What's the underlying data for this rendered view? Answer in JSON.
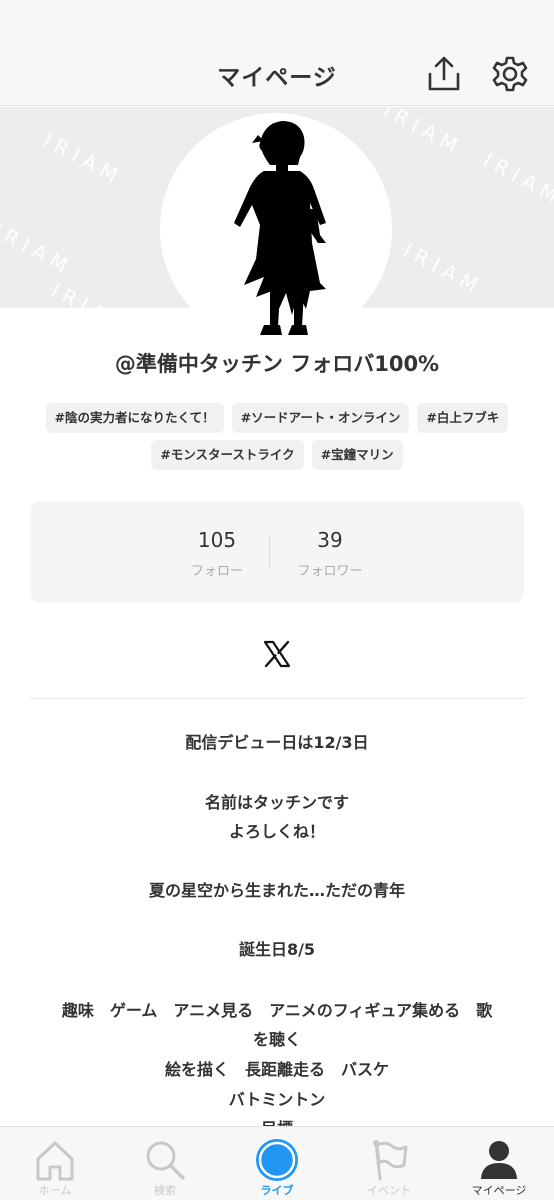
{
  "header": {
    "title": "マイページ",
    "share_icon": "share-icon",
    "settings_icon": "gear-icon"
  },
  "banner": {
    "watermark": "IRIAM"
  },
  "profile": {
    "username": "@準備中タッチン フォロバ100%",
    "tags_row1": [
      "#陰の実力者になりたくて！",
      "#ソードアート・オンライン",
      "#白上フブキ"
    ],
    "tags_row2": [
      "#モンスターストライク",
      "#宝鐘マリン"
    ]
  },
  "stats": {
    "follow_count": "105",
    "follow_label": "フォロー",
    "follower_count": "39",
    "follower_label": "フォロワー"
  },
  "social": {
    "x_icon": "x-logo-icon"
  },
  "bio": [
    "配信デビュー日は12/3日",
    "名前はタッチンです",
    "よろしくね！",
    "夏の星空から生まれた…ただの青年",
    "誕生日8/5",
    "趣味　ゲーム　アニメ見る　アニメのフィギュア集める　歌",
    "を聴く",
    "絵を描く　長距離走る　バスケ",
    "バトミントン",
    "目標"
  ],
  "tabbar": {
    "items": [
      {
        "label": "ホーム",
        "icon": "home-icon"
      },
      {
        "label": "検索",
        "icon": "search-icon"
      },
      {
        "label": "ライブ",
        "icon": "live-icon"
      },
      {
        "label": "イベント",
        "icon": "flag-icon"
      },
      {
        "label": "マイページ",
        "icon": "person-icon"
      }
    ]
  },
  "colors": {
    "accent": "#2196f3",
    "text": "#333333",
    "muted": "#aaaaaa"
  }
}
